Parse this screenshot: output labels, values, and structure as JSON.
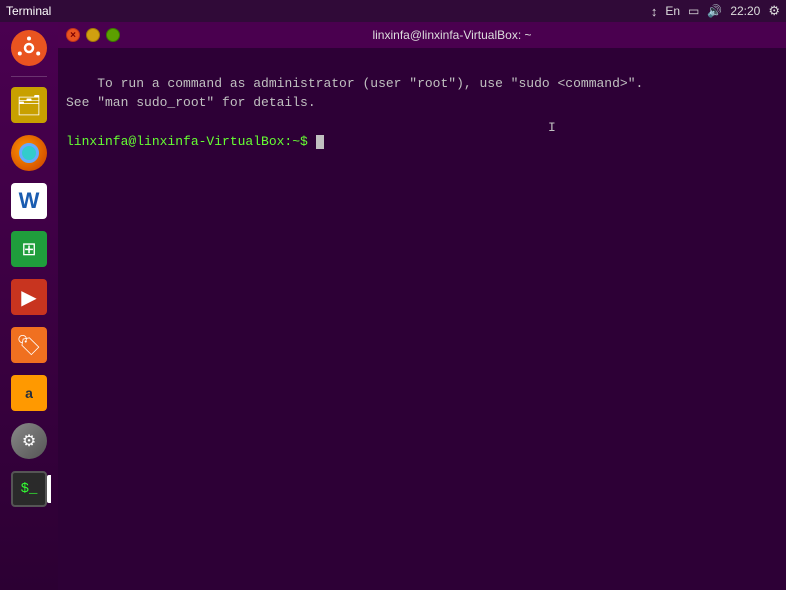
{
  "topbar": {
    "app_name": "Terminal",
    "keyboard_layout": "En",
    "time": "22:20",
    "signal_icon": "signal",
    "battery_icon": "battery",
    "volume_icon": "volume",
    "settings_icon": "settings"
  },
  "titlebar": {
    "title": "linxinfa@linxinfa-VirtualBox: ~"
  },
  "terminal": {
    "line1": "To run a command as administrator (user \"root\"), use \"sudo <command>\".",
    "line2": "See \"man sudo_root\" for details.",
    "prompt": "linxinfa@linxinfa-VirtualBox:~$"
  },
  "sidebar": {
    "icons": [
      {
        "name": "ubuntu",
        "label": "Ubuntu"
      },
      {
        "name": "files",
        "label": "Files"
      },
      {
        "name": "firefox",
        "label": "Firefox"
      },
      {
        "name": "writer",
        "label": "LibreOffice Writer"
      },
      {
        "name": "calc",
        "label": "LibreOffice Calc"
      },
      {
        "name": "impress",
        "label": "LibreOffice Impress"
      },
      {
        "name": "software",
        "label": "Ubuntu Software"
      },
      {
        "name": "amazon",
        "label": "Amazon"
      },
      {
        "name": "system-settings",
        "label": "System Settings"
      },
      {
        "name": "terminal",
        "label": "Terminal"
      }
    ]
  },
  "window_controls": {
    "close": "×",
    "minimize": "−",
    "maximize": "□"
  }
}
